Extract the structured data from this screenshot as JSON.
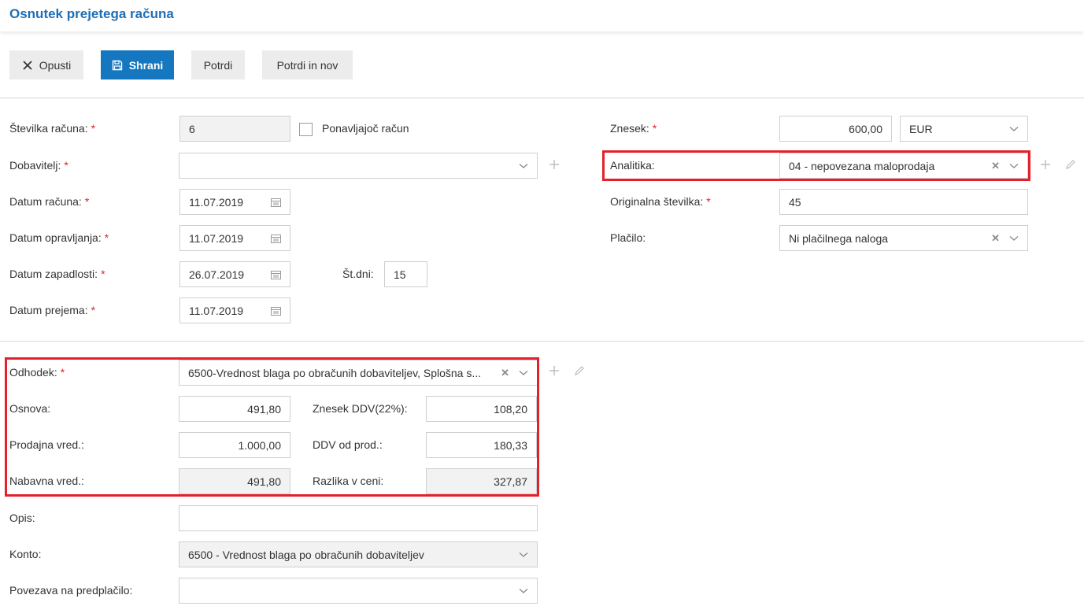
{
  "page": {
    "title": "Osnutek prejetega računa"
  },
  "toolbar": {
    "cancel_label": "Opusti",
    "save_label": "Shrani",
    "confirm_label": "Potrdi",
    "confirm_new_label": "Potrdi in nov"
  },
  "form": {
    "invoice_number": {
      "label": "Številka računa:",
      "value": "6"
    },
    "recurring": {
      "label": "Ponavljajoč račun",
      "checked": false
    },
    "supplier": {
      "label": "Dobavitelj:",
      "value": ""
    },
    "invoice_date": {
      "label": "Datum računa:",
      "value": "11.07.2019"
    },
    "service_date": {
      "label": "Datum opravljanja:",
      "value": "11.07.2019"
    },
    "due_date": {
      "label": "Datum zapadlosti:",
      "value": "26.07.2019"
    },
    "days": {
      "label": "Št.dni:",
      "value": "15"
    },
    "receipt_date": {
      "label": "Datum prejema:",
      "value": "11.07.2019"
    },
    "amount": {
      "label": "Znesek:",
      "value": "600,00",
      "currency": "EUR"
    },
    "analytics": {
      "label": "Analitika:",
      "value": "04 - nepovezana maloprodaja"
    },
    "original_number": {
      "label": "Originalna številka:",
      "value": "45"
    },
    "payment": {
      "label": "Plačilo:",
      "value": "Ni plačilnega naloga"
    },
    "expense": {
      "label": "Odhodek:",
      "value": "6500-Vrednost blaga po obračunih dobaviteljev, Splošna s..."
    },
    "base": {
      "label": "Osnova:",
      "value": "491,80"
    },
    "vat_amount": {
      "label": "Znesek DDV(22%):",
      "value": "108,20"
    },
    "sales_value": {
      "label": "Prodajna vred.:",
      "value": "1.000,00"
    },
    "vat_from_sales": {
      "label": "DDV od prod.:",
      "value": "180,33"
    },
    "purchase_value": {
      "label": "Nabavna vred.:",
      "value": "491,80"
    },
    "price_difference": {
      "label": "Razlika v ceni:",
      "value": "327,87"
    },
    "description": {
      "label": "Opis:",
      "value": ""
    },
    "account": {
      "label": "Konto:",
      "value": "6500 - Vrednost blaga po obračunih dobaviteljev"
    },
    "prepayment_link": {
      "label": "Povezava na predplačilo:",
      "value": ""
    }
  },
  "colors": {
    "accent": "#1577bf",
    "title": "#1d6fb8",
    "required": "#d9262c",
    "highlight": "#e3202b"
  },
  "icons": [
    "close-icon",
    "save-icon",
    "calendar-icon",
    "chevron-down-icon",
    "plus-icon",
    "pencil-icon",
    "clear-icon"
  ]
}
